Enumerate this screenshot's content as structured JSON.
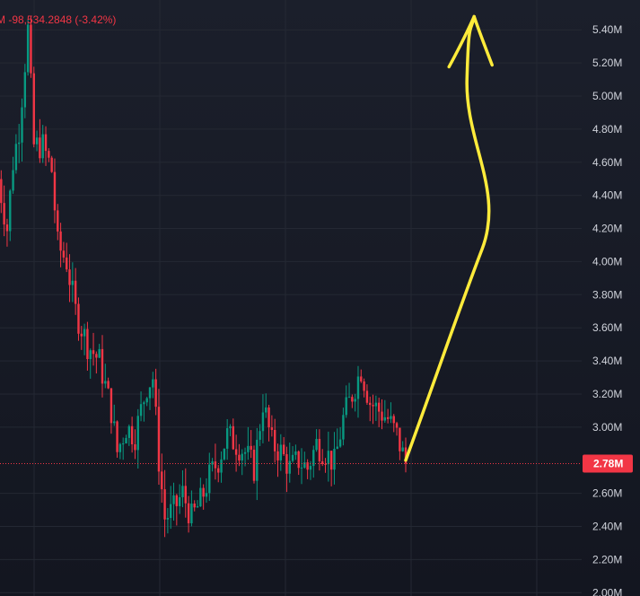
{
  "header": {
    "change_text": "M  -98,534.2848 (-3.42%)"
  },
  "colors": {
    "background": "#161a25",
    "grid": "#242833",
    "up_candle": "#089981",
    "down_candle": "#f23645",
    "price_badge": "#f23645",
    "annotation_arrow": "#ffeb3b",
    "axis_text": "#d1d4dc"
  },
  "chart_data": {
    "type": "candlestick",
    "y_axis": {
      "unit": "M",
      "ticks": [
        "5.40M",
        "5.20M",
        "5.00M",
        "4.80M",
        "4.60M",
        "4.40M",
        "4.20M",
        "4.00M",
        "3.80M",
        "3.60M",
        "3.40M",
        "3.20M",
        "3.00M",
        "2.60M",
        "2.40M",
        "2.20M",
        "2.00M"
      ],
      "tick_values": [
        5.4,
        5.2,
        5.0,
        4.8,
        4.6,
        4.4,
        4.2,
        4.0,
        3.8,
        3.6,
        3.4,
        3.2,
        3.0,
        2.6,
        2.4,
        2.2,
        2.0
      ],
      "range": [
        1.98,
        5.58
      ],
      "scale": "linear"
    },
    "grid": true,
    "last_price": {
      "value": 2.78,
      "label": "2.78M"
    },
    "trend_path": [
      [
        0,
        4.5
      ],
      [
        3,
        4.2
      ],
      [
        5,
        4.6
      ],
      [
        7,
        4.8
      ],
      [
        9,
        5.2
      ],
      [
        10,
        5.4
      ],
      [
        12,
        4.7
      ],
      [
        15,
        4.7
      ],
      [
        18,
        4.55
      ],
      [
        20,
        4.1
      ],
      [
        23,
        4.0
      ],
      [
        26,
        3.7
      ],
      [
        30,
        3.5
      ],
      [
        34,
        3.4
      ],
      [
        38,
        3.1
      ],
      [
        40,
        2.85
      ],
      [
        43,
        3.0
      ],
      [
        46,
        2.95
      ],
      [
        50,
        3.25
      ],
      [
        52,
        3.3
      ],
      [
        54,
        2.8
      ],
      [
        56,
        2.45
      ],
      [
        59,
        2.5
      ],
      [
        62,
        2.6
      ],
      [
        65,
        2.45
      ],
      [
        68,
        2.55
      ],
      [
        71,
        2.7
      ],
      [
        74,
        2.8
      ],
      [
        77,
        2.95
      ],
      [
        80,
        2.9
      ],
      [
        83,
        2.85
      ],
      [
        86,
        2.75
      ],
      [
        89,
        3.15
      ],
      [
        92,
        2.9
      ],
      [
        95,
        2.85
      ],
      [
        98,
        2.75
      ],
      [
        101,
        2.8
      ],
      [
        104,
        2.75
      ],
      [
        107,
        2.9
      ],
      [
        110,
        2.85
      ],
      [
        113,
        2.78
      ],
      [
        116,
        3.05
      ],
      [
        119,
        3.2
      ],
      [
        122,
        3.35
      ],
      [
        125,
        3.15
      ],
      [
        128,
        3.1
      ],
      [
        131,
        3.05
      ],
      [
        134,
        2.95
      ],
      [
        137,
        2.78
      ]
    ],
    "candle_count": 138,
    "annotation": {
      "kind": "hand-drawn arrow",
      "direction": "up",
      "start": [
        137,
        2.8
      ],
      "end": [
        160,
        5.48
      ]
    }
  }
}
